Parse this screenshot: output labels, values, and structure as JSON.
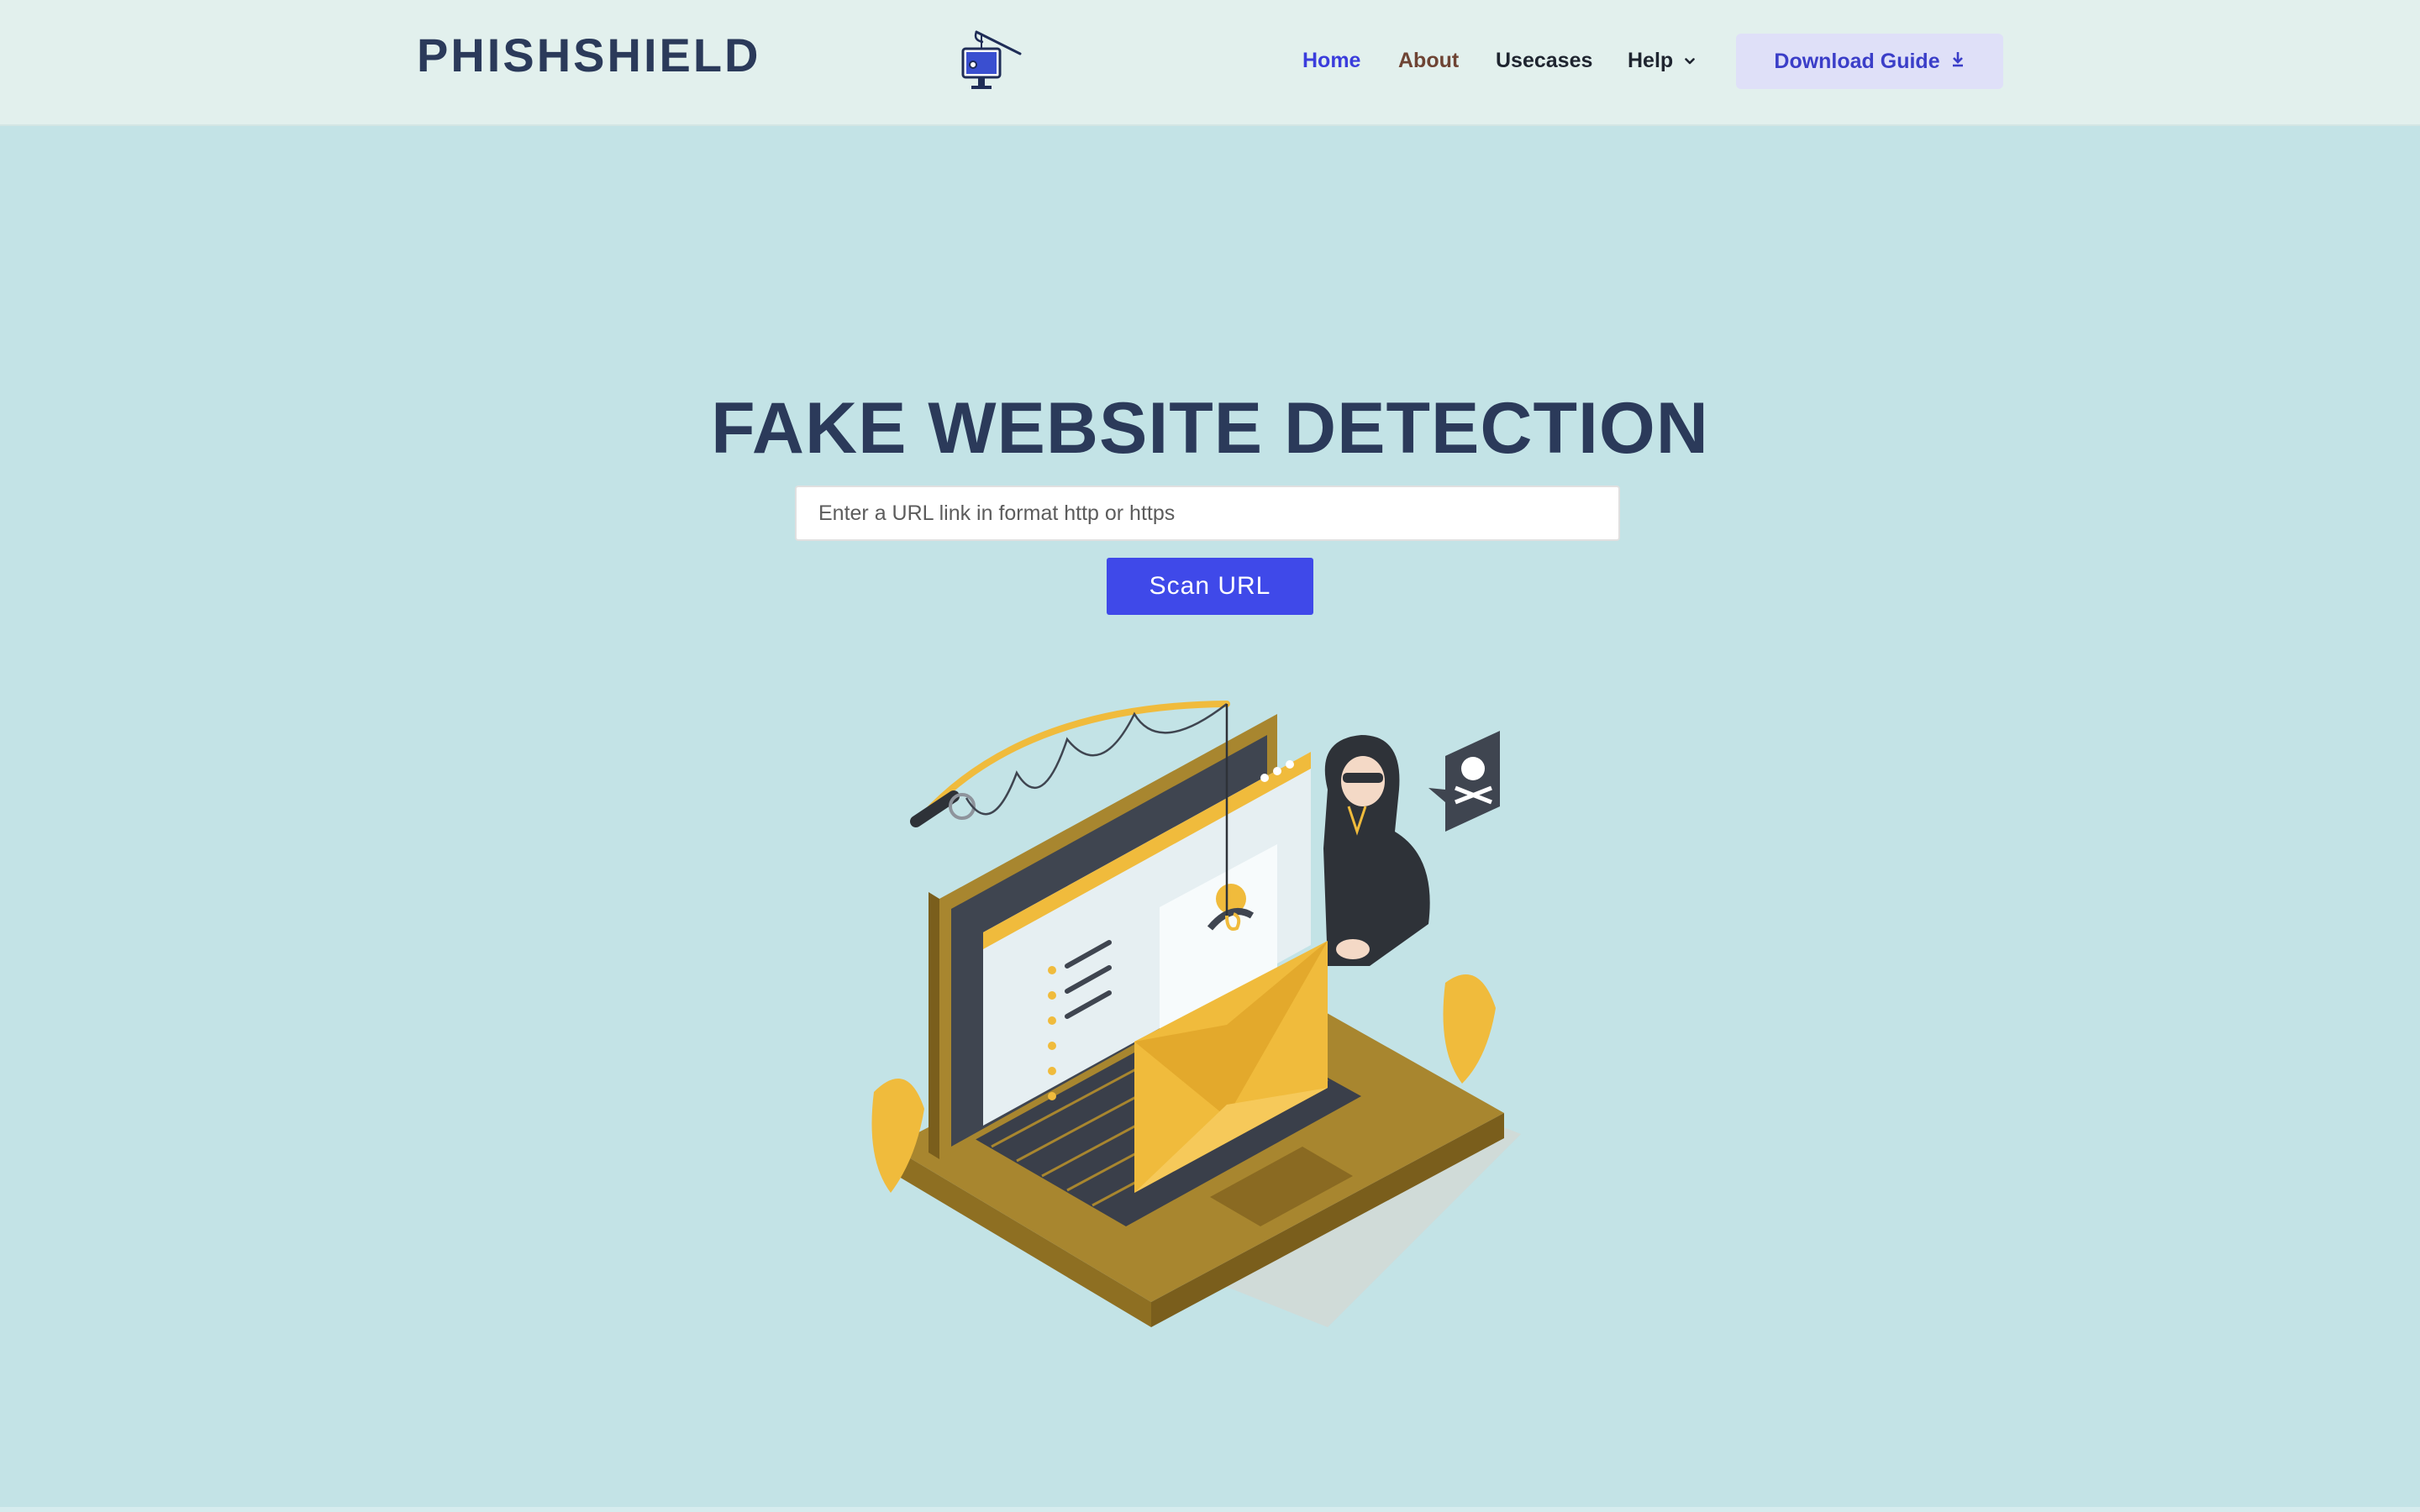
{
  "header": {
    "brand": "PHISHSHIELD",
    "logo_icon": "fishing-hook-computer-icon",
    "nav": {
      "home": "Home",
      "about": "About",
      "usecases": "Usecases",
      "help": "Help"
    },
    "download_label": "Download Guide"
  },
  "hero": {
    "title": "FAKE WEBSITE DETECTION",
    "url_placeholder": "Enter a URL link in format http or https",
    "url_value": "",
    "scan_label": "Scan URL",
    "illustration": "phishing-laptop-hacker-illustration"
  },
  "colors": {
    "page_bg": "#c3e3e6",
    "header_bg": "#e2f0ed",
    "brand_text": "#2b3a5a",
    "nav_active": "#3b3ddc",
    "nav_about": "#6e4434",
    "download_bg": "#dfe0f8",
    "scan_button": "#3f49e9",
    "laptop": "#a8862f",
    "envelope": "#f0bb3c"
  }
}
